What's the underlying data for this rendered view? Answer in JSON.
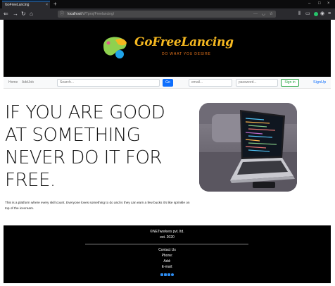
{
  "browser": {
    "tab_title": "GoFreeLancing",
    "tab_close": "×",
    "new_tab": "+",
    "url_host": "localhost",
    "url_path": "/WTproj/Freelancing/",
    "window_controls": [
      "–",
      "□",
      "×"
    ],
    "nav_icons": [
      "back-icon",
      "forward-icon",
      "reload-icon",
      "home-icon"
    ]
  },
  "brand": {
    "name": "GoFreeLancing",
    "tagline": "DO WHAT YOU DESIRE",
    "colors": {
      "name": "#f5b820",
      "tagline": "#e9761d"
    }
  },
  "nav": {
    "home": "Home",
    "addjob": "AddJob",
    "search_placeholder": "Search...",
    "go": "Go",
    "email_placeholder": "email...",
    "password_placeholder": "password...",
    "signin": "Sign in",
    "signup": "SignUp"
  },
  "hero": {
    "headline": [
      "IF YOU ARE GOOD",
      "AT SOMETHING",
      "NEVER DO IT FOR",
      "FREE."
    ],
    "description": "This is a platform where every skill count. Everyone loves something to do and is they can earn a few bucks it's like sprinkle on top of the icecream."
  },
  "footer": {
    "company": "©NETworkers pvt. ltd.",
    "est": "est. 2020",
    "contact": "Contact Us",
    "phone": "Phone:",
    "add": "Add:",
    "email": "E-mail:",
    "social": [
      "facebook-icon",
      "twitter-icon",
      "instagram-icon",
      "github-icon"
    ]
  }
}
